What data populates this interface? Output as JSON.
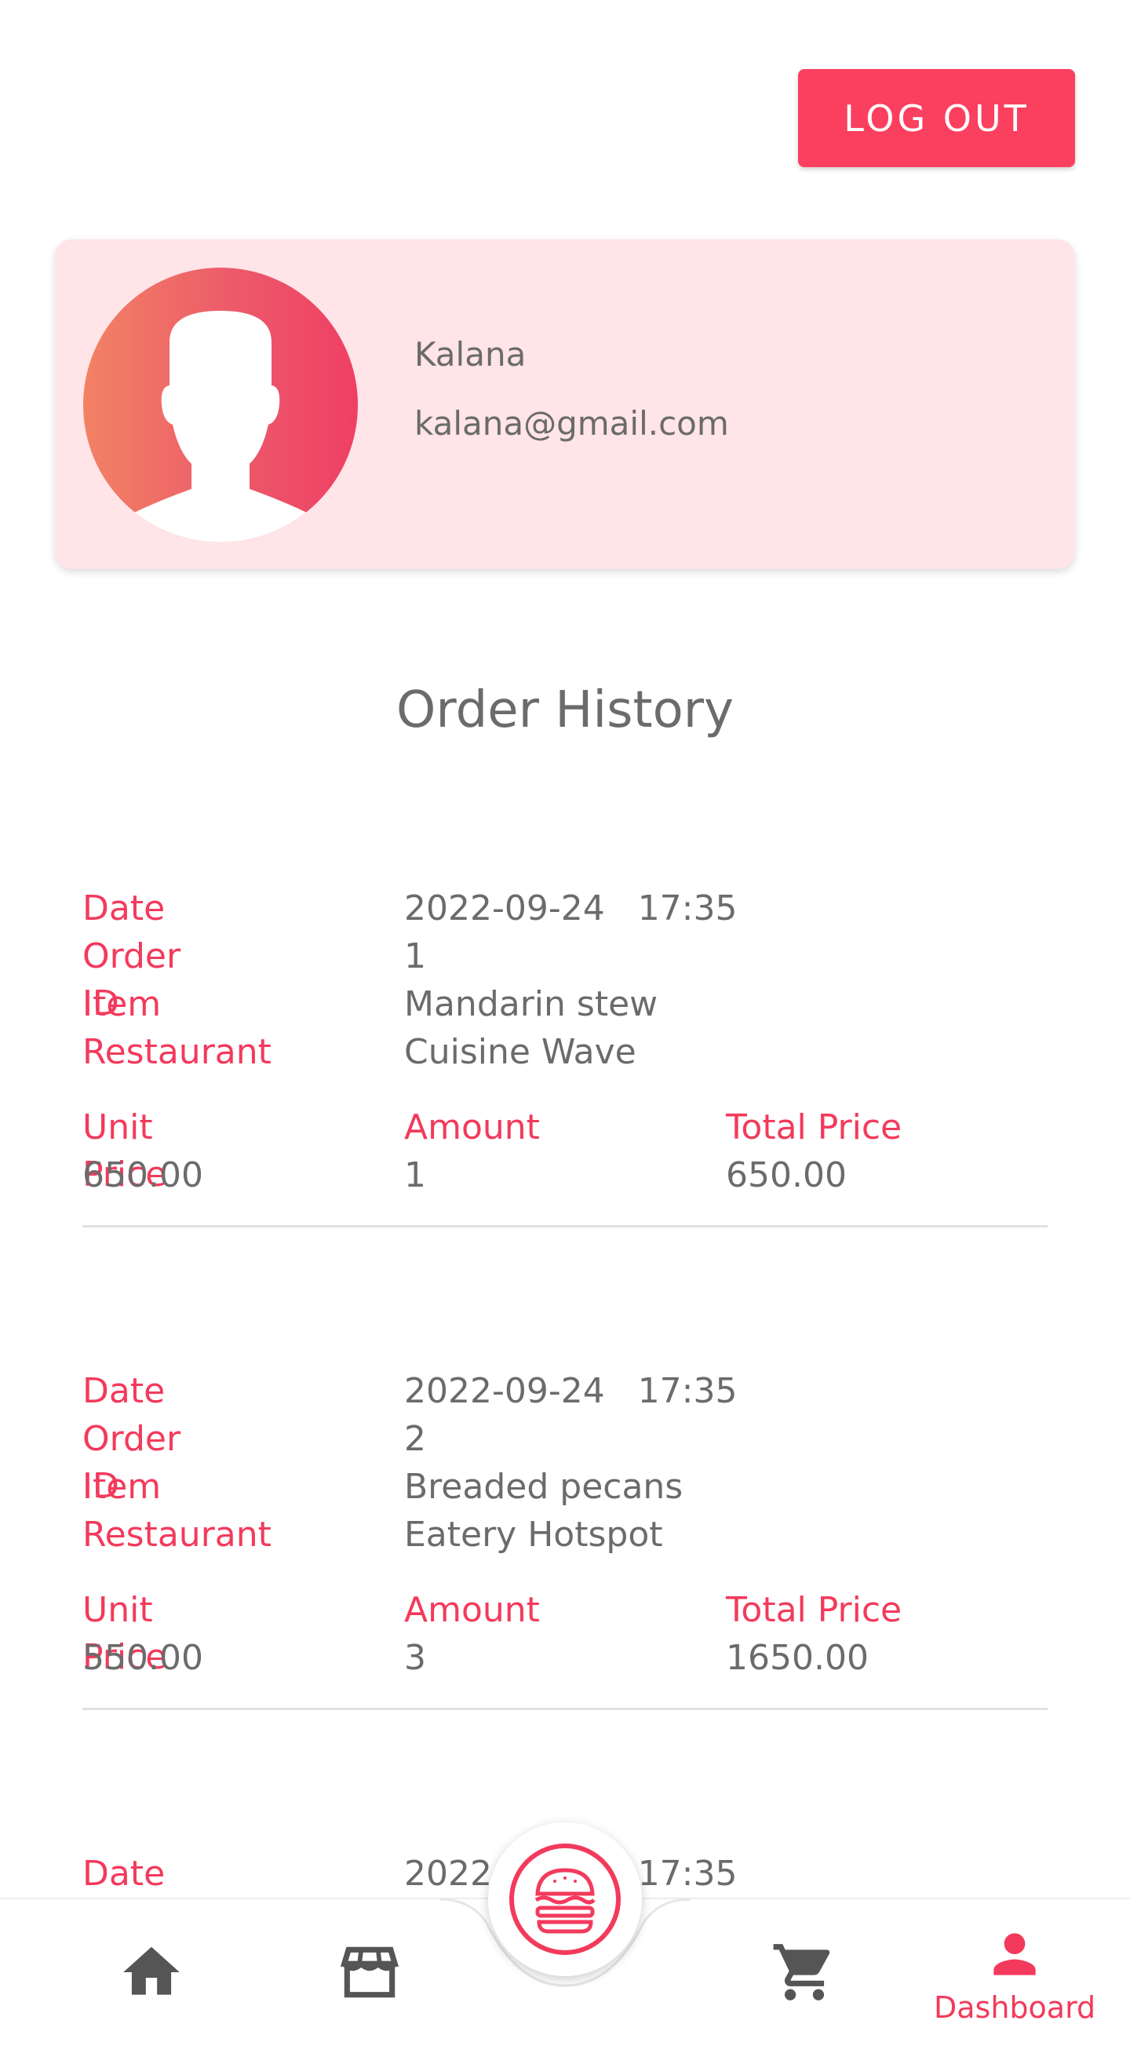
{
  "header": {
    "logout_label": "LOG OUT"
  },
  "profile": {
    "name": "Kalana",
    "email": "kalana@gmail.com"
  },
  "section_title": "Order History",
  "labels": {
    "date": "Date",
    "order_id": "Order ID",
    "item": "Item",
    "restaurant": "Restaurant",
    "unit_price": "Unit Price",
    "amount": "Amount",
    "total_price": "Total Price"
  },
  "orders": [
    {
      "date": "2022-09-24",
      "time": "17:35",
      "order_id": "1",
      "item": "Mandarin stew",
      "restaurant": "Cuisine Wave",
      "unit_price": "650.00",
      "amount": "1",
      "total_price": "650.00"
    },
    {
      "date": "2022-09-24",
      "time": "17:35",
      "order_id": "2",
      "item": "Breaded pecans",
      "restaurant": "Eatery Hotspot",
      "unit_price": "550.00",
      "amount": "3",
      "total_price": "1650.00"
    },
    {
      "date": "2022-09-24",
      "time": "17:35"
    }
  ],
  "nav": {
    "items": [
      {
        "icon": "home-icon"
      },
      {
        "icon": "store-icon"
      },
      {
        "icon": "burger-icon"
      },
      {
        "icon": "cart-icon"
      },
      {
        "icon": "person-icon",
        "label": "Dashboard"
      }
    ]
  },
  "colors": {
    "accent": "#f33a5c",
    "button": "#fb3f5f",
    "card_bg": "#ffe4e8",
    "text": "#6b6b6b",
    "icon_gray": "#555555"
  }
}
